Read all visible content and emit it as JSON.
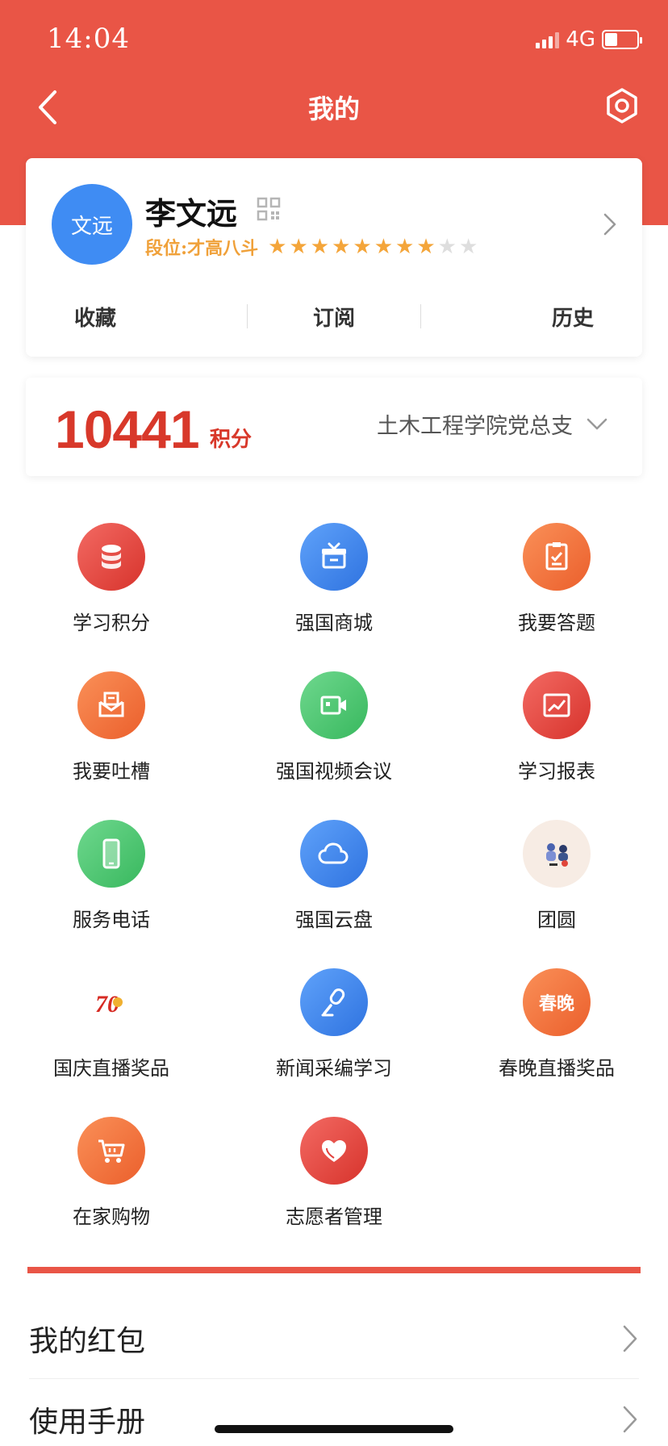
{
  "status_bar": {
    "time": "14:04",
    "network": "4G"
  },
  "nav": {
    "title": "我的"
  },
  "profile": {
    "avatar_text": "文远",
    "name": "李文远",
    "rank_label": "段位:才高八斗",
    "stars_filled": 8,
    "stars_total": 10,
    "tabs": [
      "收藏",
      "订阅",
      "历史"
    ]
  },
  "points": {
    "value": "10441",
    "unit": "积分",
    "branch": "土木工程学院党总支"
  },
  "grid": [
    {
      "label": "学习积分",
      "icon": "database-icon",
      "color": "red"
    },
    {
      "label": "强国商城",
      "icon": "gift-box-icon",
      "color": "blue"
    },
    {
      "label": "我要答题",
      "icon": "clipboard-check-icon",
      "color": "orange"
    },
    {
      "label": "我要吐槽",
      "icon": "mail-feedback-icon",
      "color": "orange"
    },
    {
      "label": "强国视频会议",
      "icon": "video-camera-icon",
      "color": "green"
    },
    {
      "label": "学习报表",
      "icon": "chart-report-icon",
      "color": "red"
    },
    {
      "label": "服务电话",
      "icon": "phone-icon",
      "color": "green"
    },
    {
      "label": "强国云盘",
      "icon": "cloud-icon",
      "color": "blue"
    },
    {
      "label": "团圆",
      "icon": "reunion-illustration-icon",
      "color": "cream"
    },
    {
      "label": "国庆直播奖品",
      "icon": "anniversary-70-icon",
      "color": "white"
    },
    {
      "label": "新闻采编学习",
      "icon": "microphone-icon",
      "color": "blue"
    },
    {
      "label": "春晚直播奖品",
      "icon": "spring-gala-icon",
      "color": "orange",
      "icon_text": "春晚"
    },
    {
      "label": "在家购物",
      "icon": "shopping-cart-icon",
      "color": "orange"
    },
    {
      "label": "志愿者管理",
      "icon": "heart-icon",
      "color": "red"
    }
  ],
  "list": [
    {
      "label": "我的红包"
    },
    {
      "label": "使用手册"
    }
  ],
  "colors": {
    "brand_red": "#e95546",
    "points_red": "#d8382a",
    "star_gold": "#f4a53a"
  }
}
